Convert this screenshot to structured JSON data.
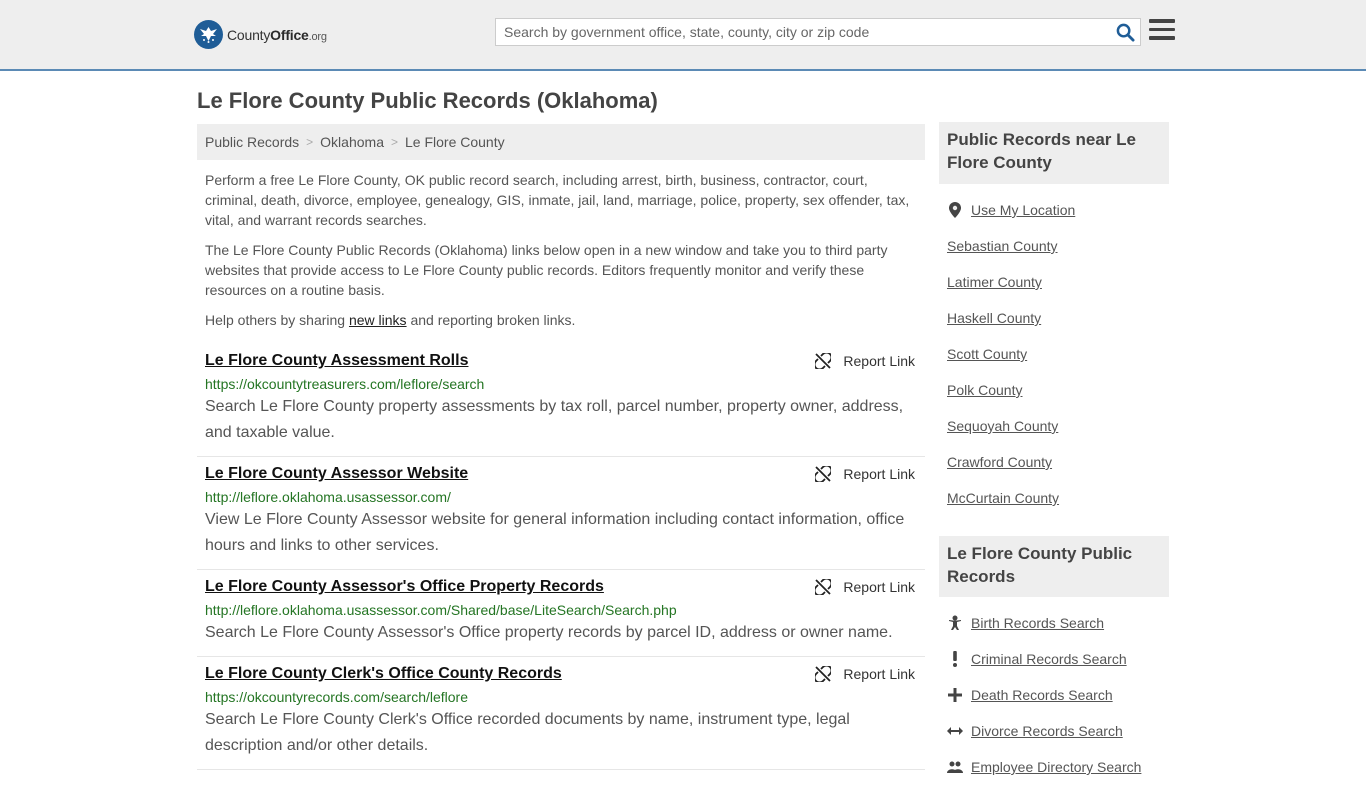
{
  "header": {
    "logo_county": "County",
    "logo_office": "Office",
    "logo_org": ".org",
    "search_placeholder": "Search by government office, state, county, city or zip code"
  },
  "page": {
    "title": "Le Flore County Public Records (Oklahoma)"
  },
  "breadcrumb": [
    "Public Records",
    "Oklahoma",
    "Le Flore County"
  ],
  "intro": {
    "p1": "Perform a free Le Flore County, OK public record search, including arrest, birth, business, contractor, court, criminal, death, divorce, employee, genealogy, GIS, inmate, jail, land, marriage, police, property, sex offender, tax, vital, and warrant records searches.",
    "p2": "The Le Flore County Public Records (Oklahoma) links below open in a new window and take you to third party websites that provide access to Le Flore County public records. Editors frequently monitor and verify these resources on a routine basis.",
    "p3_before": "Help others by sharing ",
    "p3_link": "new links",
    "p3_after": " and reporting broken links."
  },
  "results": [
    {
      "title": "Le Flore County Assessment Rolls",
      "url": "https://okcountytreasurers.com/leflore/search",
      "desc": "Search Le Flore County property assessments by tax roll, parcel number, property owner, address, and taxable value.",
      "report": "Report Link"
    },
    {
      "title": "Le Flore County Assessor Website",
      "url": "http://leflore.oklahoma.usassessor.com/",
      "desc": "View Le Flore County Assessor website for general information including contact information, office hours and links to other services.",
      "report": "Report Link"
    },
    {
      "title": "Le Flore County Assessor's Office Property Records",
      "url": "http://leflore.oklahoma.usassessor.com/Shared/base/LiteSearch/Search.php",
      "desc": "Search Le Flore County Assessor's Office property records by parcel ID, address or owner name.",
      "report": "Report Link"
    },
    {
      "title": "Le Flore County Clerk's Office County Records",
      "url": "https://okcountyrecords.com/search/leflore",
      "desc": "Search Le Flore County Clerk's Office recorded documents by name, instrument type, legal description and/or other details.",
      "report": "Report Link"
    }
  ],
  "sidebar": {
    "near_title": "Public Records near Le Flore County",
    "use_location": "Use My Location",
    "nearby": [
      "Sebastian County",
      "Latimer County",
      "Haskell County",
      "Scott County",
      "Polk County",
      "Sequoyah County",
      "Crawford County",
      "McCurtain County"
    ],
    "records_title": "Le Flore County Public Records",
    "records": [
      {
        "label": "Birth Records Search",
        "icon": "baby-icon"
      },
      {
        "label": "Criminal Records Search",
        "icon": "exclamation-icon"
      },
      {
        "label": "Death Records Search",
        "icon": "cross-icon"
      },
      {
        "label": "Divorce Records Search",
        "icon": "arrows-horizontal-icon"
      },
      {
        "label": "Employee Directory Search",
        "icon": "people-icon"
      }
    ]
  },
  "colors": {
    "brand_blue": "#1f5d97",
    "url_green": "#247523",
    "header_bg": "#eeeeee"
  }
}
